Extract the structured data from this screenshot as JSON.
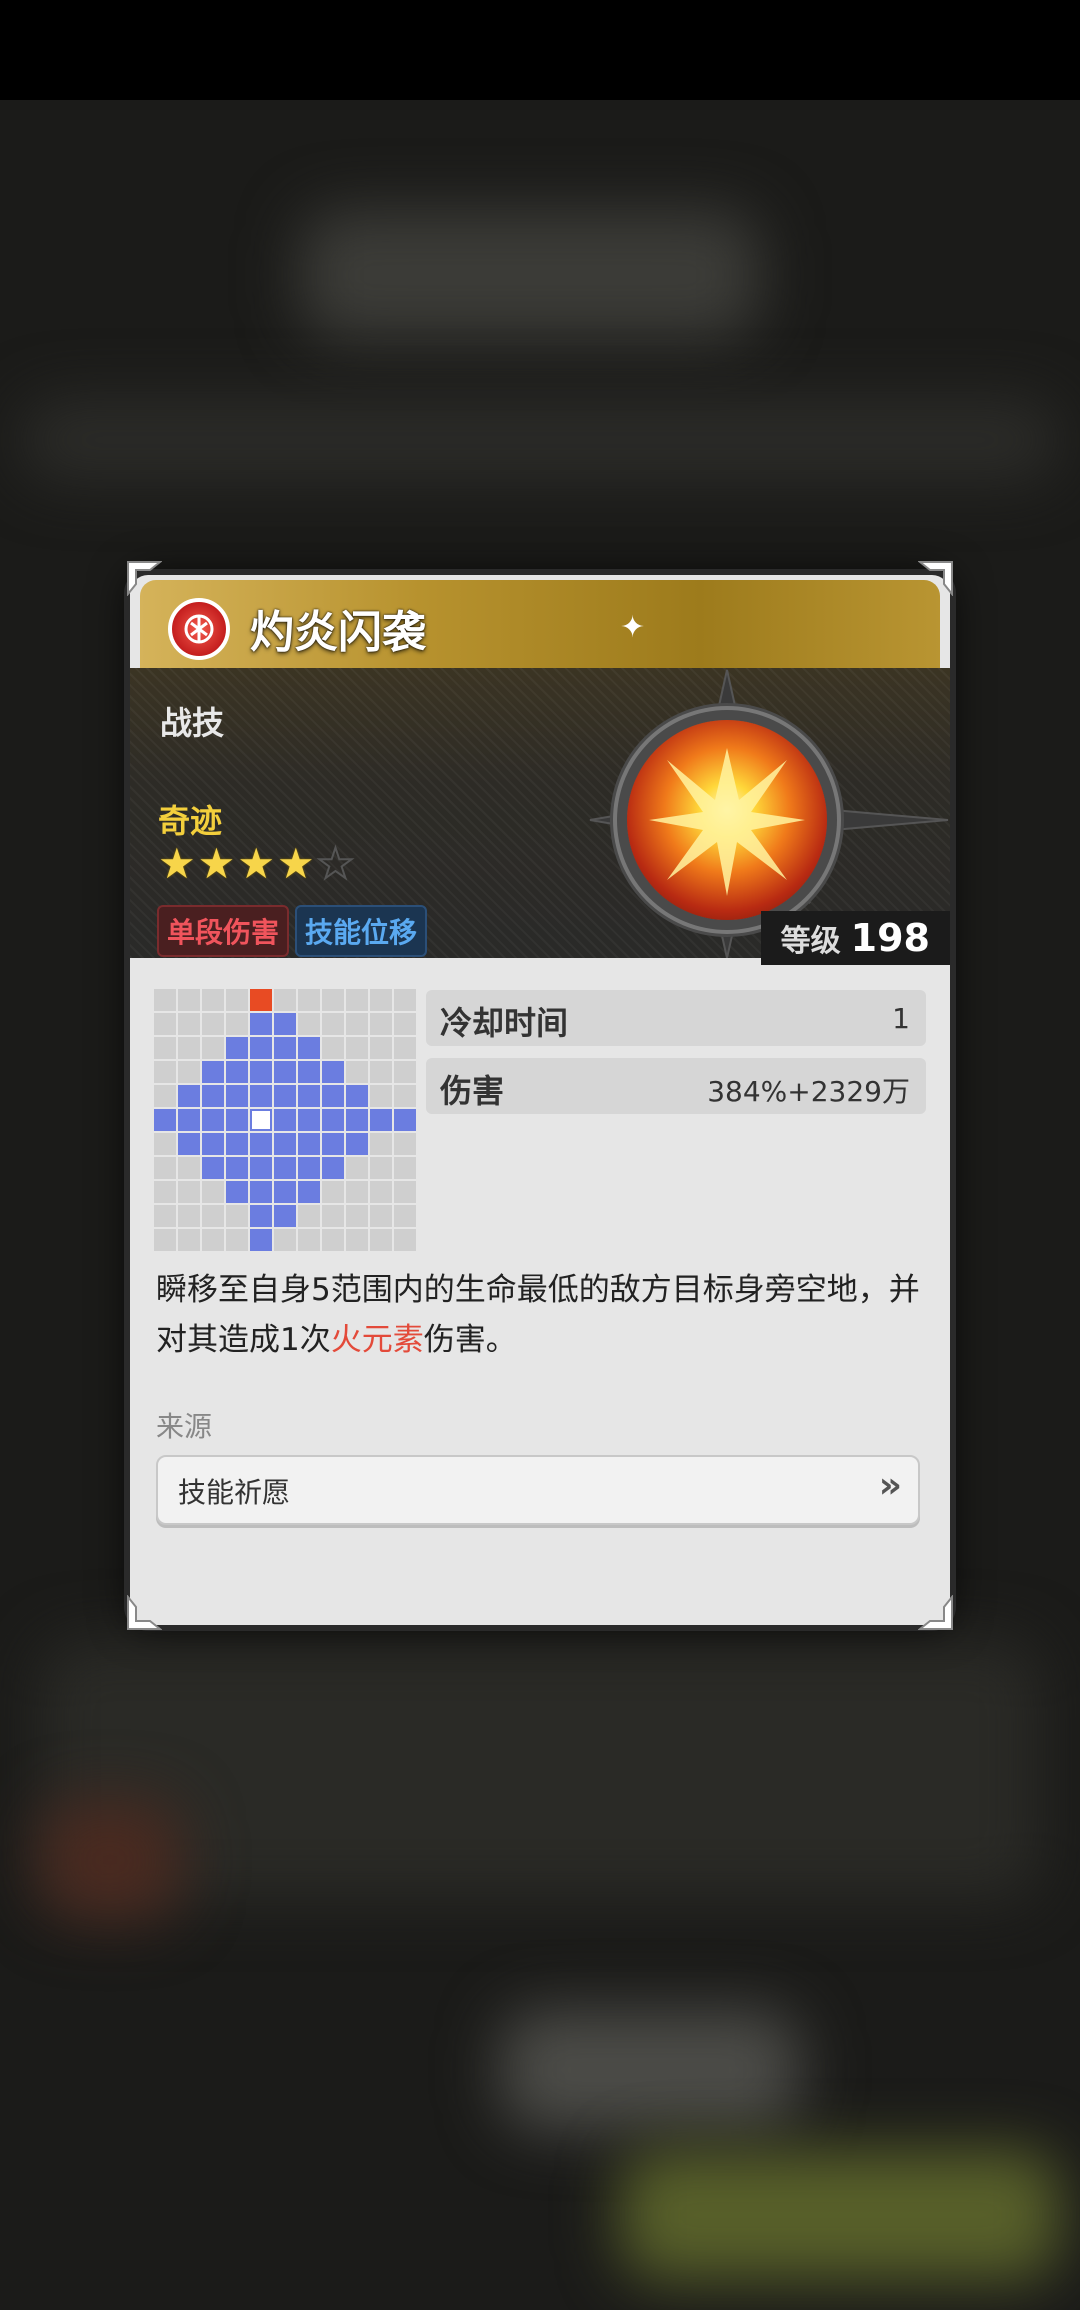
{
  "skill": {
    "name": "灼炎闪袭",
    "type": "战技",
    "rarity_label": "奇迹",
    "stars": 4,
    "stars_max": 5,
    "tags": [
      "单段伤害",
      "技能位移"
    ],
    "level_label": "等级",
    "level_value": "198"
  },
  "stats": [
    {
      "label": "冷却时间",
      "value": "1"
    },
    {
      "label": "伤害",
      "value": "384%+2329万"
    }
  ],
  "description": {
    "part1": "瞬移至自身5范围内的生命最低的敌方目标身旁空地，并对其造成1次",
    "highlight": "火元素",
    "part2": "伤害。"
  },
  "source": {
    "label": "来源",
    "button_label": "技能祈愿"
  },
  "range_grid": {
    "size": 11,
    "legend": "o=target marker, b=range, w=self",
    "rows": [
      "....o......",
      "....bb.....",
      "...bbbb....",
      "..bbbbbb...",
      ".bbbbbbbb..",
      "bbbbwbbbbbb",
      ".bbbbbbbb..",
      "..bbbbbb...",
      "...bbbb....",
      "....bb.....",
      "....b......"
    ]
  },
  "colors": {
    "fire_highlight": "#e34a3a",
    "range_blue": "#6b7de0",
    "marker_orange": "#e84b23",
    "star_gold": "#f7d54a"
  }
}
